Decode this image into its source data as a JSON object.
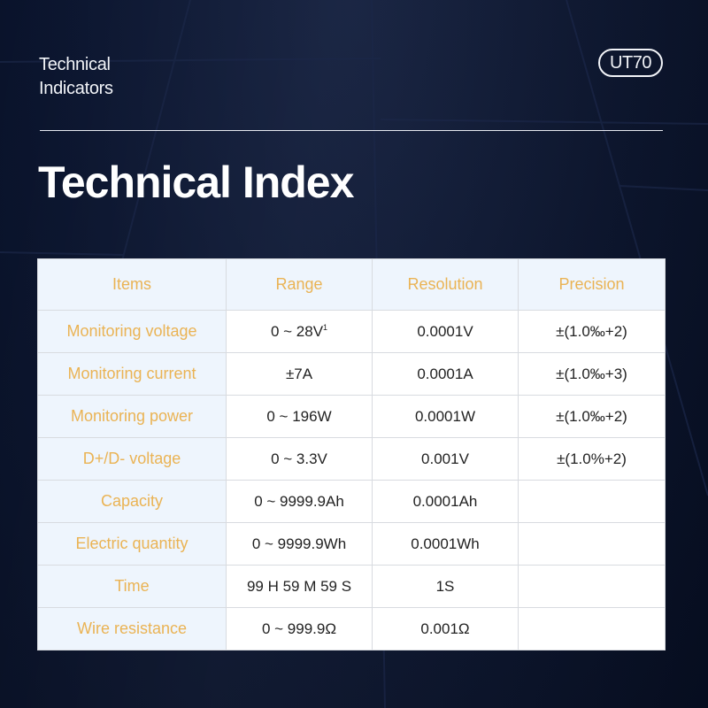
{
  "header": {
    "subtitle_line1": "Technical",
    "subtitle_line2": "Indicators",
    "model_badge": "UT70",
    "title": "Technical Index"
  },
  "colors": {
    "background": "#0a1430",
    "item_text": "#eab354",
    "header_cell_bg": "#eef5fd",
    "value_text": "#222222"
  },
  "table": {
    "columns": [
      "Items",
      "Range",
      "Resolution",
      "Precision"
    ],
    "rows": [
      {
        "item": "Monitoring voltage",
        "range": "0 ~ 28V",
        "range_sup": "1",
        "resolution": "0.0001V",
        "precision": "±(1.0‰+2)"
      },
      {
        "item": "Monitoring current",
        "range": "±7A",
        "range_sup": "",
        "resolution": "0.0001A",
        "precision": "±(1.0‰+3)"
      },
      {
        "item": "Monitoring power",
        "range": "0 ~ 196W",
        "range_sup": "",
        "resolution": "0.0001W",
        "precision": "±(1.0‰+2)"
      },
      {
        "item": "D+/D- voltage",
        "range": "0 ~ 3.3V",
        "range_sup": "",
        "resolution": "0.001V",
        "precision": "±(1.0%+2)"
      },
      {
        "item": "Capacity",
        "range": "0 ~ 9999.9Ah",
        "range_sup": "",
        "resolution": "0.0001Ah",
        "precision": ""
      },
      {
        "item": "Electric quantity",
        "range": "0 ~ 9999.9Wh",
        "range_sup": "",
        "resolution": "0.0001Wh",
        "precision": ""
      },
      {
        "item": "Time",
        "range": "99 H 59 M 59 S",
        "range_sup": "",
        "resolution": "1S",
        "precision": ""
      },
      {
        "item": "Wire resistance",
        "range": "0 ~ 999.9Ω",
        "range_sup": "",
        "resolution": "0.001Ω",
        "precision": ""
      }
    ]
  }
}
